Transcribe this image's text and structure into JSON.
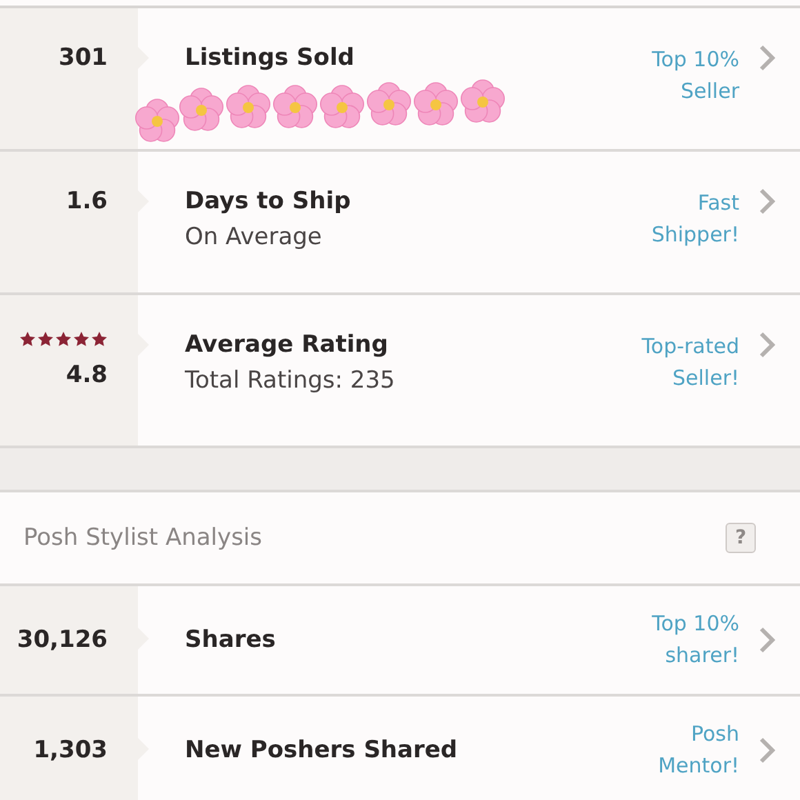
{
  "seller_stats": [
    {
      "value": "301",
      "title": "Listings Sold",
      "badge": "Top 10%\nSeller",
      "stickers": true
    },
    {
      "value": "1.6",
      "title": "Days to Ship",
      "subtitle": "On Average",
      "badge": "Fast\nShipper!"
    },
    {
      "value": "4.8",
      "stars": 5,
      "title": "Average Rating",
      "subtitle": "Total Ratings: 235",
      "badge": "Top-rated\nSeller!"
    }
  ],
  "section": {
    "title": "Posh Stylist Analysis",
    "help": "?"
  },
  "stylist_stats": [
    {
      "value": "30,126",
      "title": "Shares",
      "badge": "Top 10%\nsharer!"
    },
    {
      "value": "1,303",
      "title": "New Poshers Shared",
      "badge": "Posh\nMentor!"
    }
  ]
}
